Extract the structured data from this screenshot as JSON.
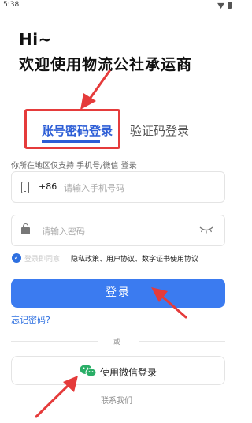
{
  "status_bar": {
    "time": "5:38"
  },
  "greeting": {
    "line1": "Hi~",
    "line2": "欢迎使用物流公社承运商"
  },
  "tabs": [
    {
      "label": "账号密码登录",
      "active": true
    },
    {
      "label": "验证码登录",
      "active": false
    }
  ],
  "region_note": "你所在地区仅支持 手机号/微信 登录",
  "phone": {
    "country_code": "+86",
    "placeholder": "请输入手机号码",
    "value": ""
  },
  "password": {
    "placeholder": "请输入密码",
    "value": ""
  },
  "agreement": {
    "checked": true,
    "faded_prefix": "登录即同意",
    "text": "隐私政策、用户协议、数字证书使用协议"
  },
  "login_button": "登录",
  "forgot_password": "忘记密码?",
  "divider_text": "或",
  "wechat_button": "使用微信登录",
  "contact_link": "联系我们",
  "colors": {
    "primary": "#3b7bf0",
    "active_tab": "#2d5ed6",
    "highlight": "#e53b3b",
    "wechat": "#2aae67"
  },
  "icons": [
    "wifi-icon",
    "battery-icon",
    "phone-icon",
    "lock-icon",
    "eye-closed-icon",
    "check-icon",
    "wechat-icon"
  ]
}
